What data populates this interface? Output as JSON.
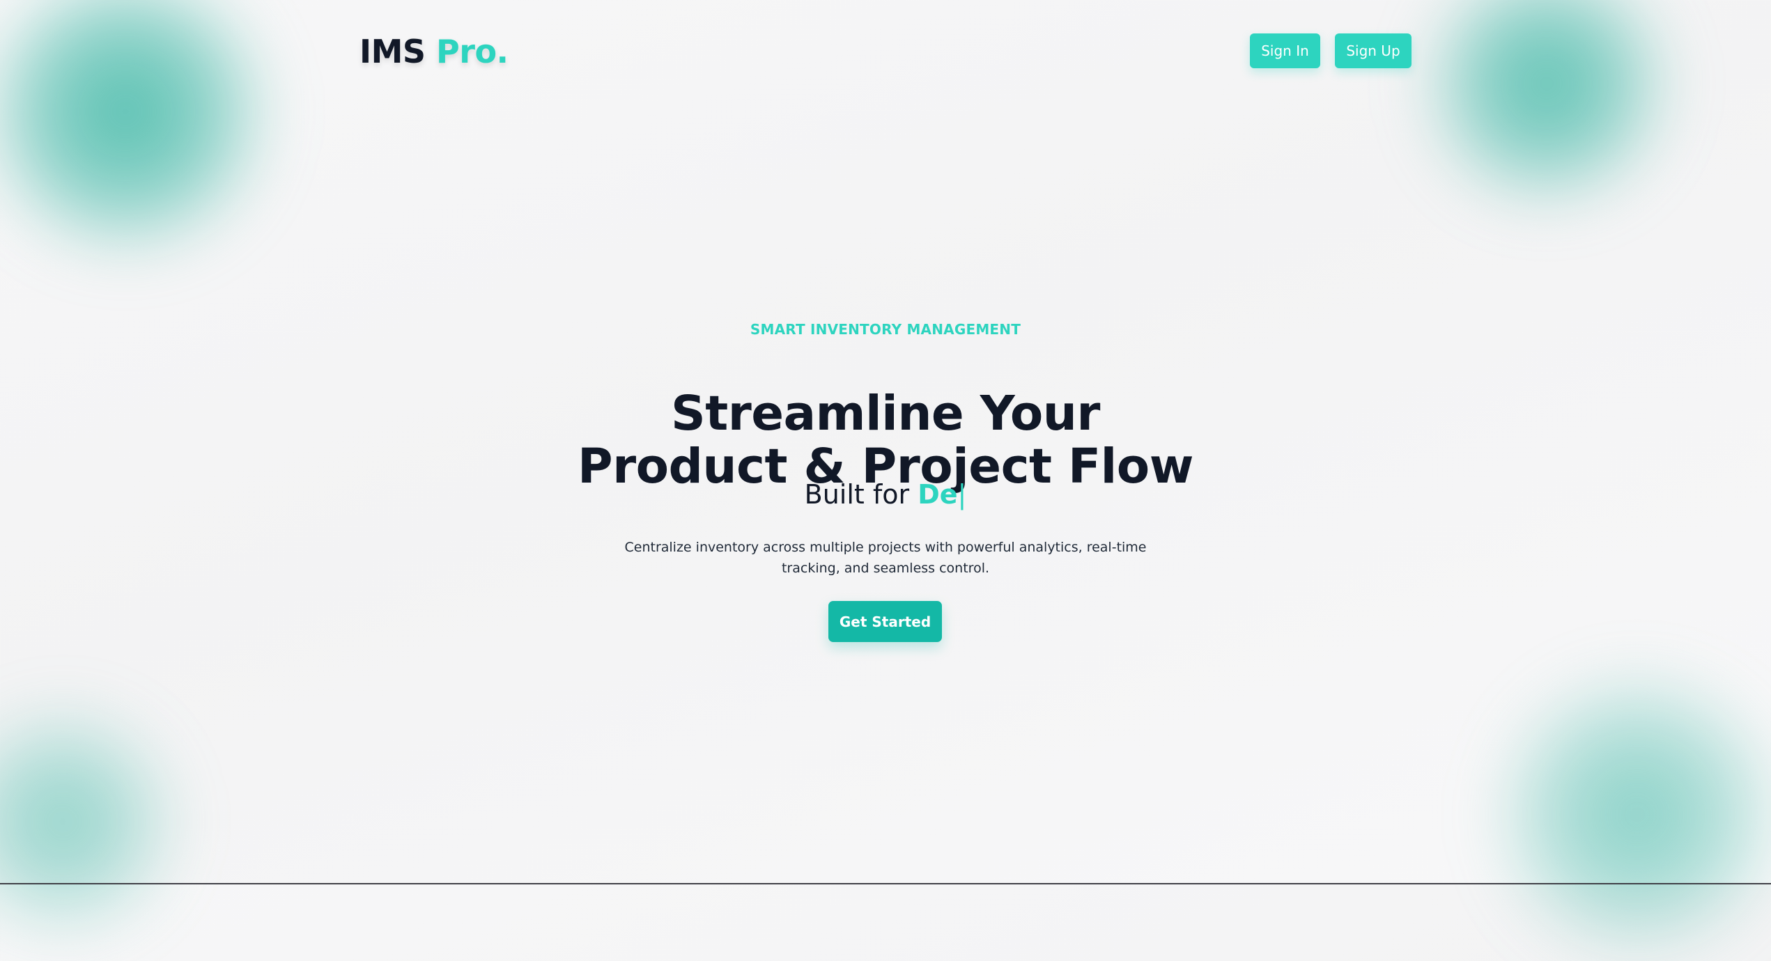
{
  "brand": {
    "name": "IMS",
    "suffix": "Pro."
  },
  "nav": {
    "sign_in": "Sign In",
    "sign_up": "Sign Up"
  },
  "hero": {
    "eyebrow": "SMART INVENTORY MANAGEMENT",
    "headline_line1": "Streamline Your",
    "headline_line2": "Product & Project Flow",
    "built_for_prefix": "Built for",
    "built_for_typed": "De",
    "cursor": "|",
    "description": "Centralize inventory across multiple projects with powerful analytics, real-time tracking, and seamless control.",
    "cta": "Get Started"
  },
  "colors": {
    "accent": "#2dd4bf",
    "button_dark_teal": "#14b8a6",
    "text_dark": "#111827",
    "background": "#f6f6f7"
  }
}
